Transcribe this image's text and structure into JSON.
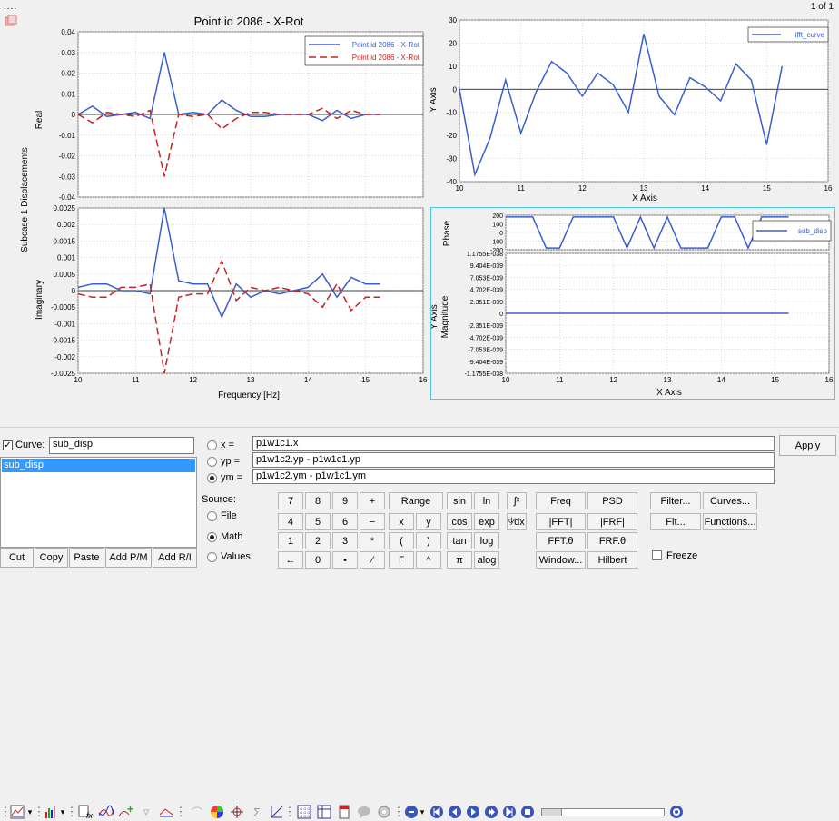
{
  "page_indicator": "1 of 1",
  "plot_main": {
    "title": "Point id 2086 - X-Rot",
    "y_label_outer": "Subcase 1 Displacements",
    "top_ylabel": "Real",
    "bottom_ylabel": "Imaginary",
    "xlabel": "Frequency [Hz]",
    "legend": [
      "Point id 2086 - X-Rot",
      "Point id 2086 - X-Rot"
    ],
    "top_yticks": [
      "0.04",
      "0.03",
      "0.02",
      "0.01",
      "0",
      "-0.01",
      "-0.02",
      "-0.03",
      "-0.04"
    ],
    "bottom_yticks": [
      "0.0025",
      "0.002",
      "0.0015",
      "0.001",
      "0.0005",
      "0",
      "-0.0005",
      "-0.001",
      "-0.0015",
      "-0.002",
      "-0.0025"
    ],
    "xticks": [
      "10",
      "11",
      "12",
      "13",
      "14",
      "15",
      "16"
    ]
  },
  "plot_ifft": {
    "legend": "ifft_curve",
    "xlabel": "X Axis",
    "ylabel": "Y Axis",
    "yticks": [
      "30",
      "20",
      "10",
      "0",
      "-10",
      "-20",
      "-30",
      "-40"
    ],
    "xticks": [
      "10",
      "11",
      "12",
      "13",
      "14",
      "15",
      "16"
    ]
  },
  "plot_sub": {
    "legend": "sub_disp",
    "phase_label": "Phase",
    "phase_ticks": [
      "200",
      "100",
      "0",
      "-100",
      "-200"
    ],
    "mag_label": "Magnitude",
    "yaxis_label": "Y Axis",
    "mag_ticks": [
      "1.1755E-038",
      "9.404E-039",
      "7.053E-039",
      "4.702E-039",
      "2.351E-039",
      "0",
      "-2.351E-039",
      "-4.702E-039",
      "-7.053E-039",
      "-9.404E-039",
      "-1.1755E-038"
    ],
    "xticks": [
      "10",
      "11",
      "12",
      "13",
      "14",
      "15",
      "16"
    ],
    "xlabel": "X Axis"
  },
  "chart_data": [
    {
      "type": "line",
      "title": "Point id 2086 - X-Rot",
      "xlabel": "Frequency [Hz]",
      "ylabel": "Real",
      "xlim": [
        10,
        16
      ],
      "ylim": [
        -0.04,
        0.04
      ],
      "x": [
        10,
        10.25,
        10.5,
        10.75,
        11,
        11.25,
        11.5,
        11.75,
        12,
        12.25,
        12.5,
        12.75,
        13,
        13.25,
        13.5,
        13.75,
        14,
        14.25,
        14.5,
        14.75,
        15,
        15.25
      ],
      "series": [
        {
          "name": "Point id 2086 - X-Rot",
          "color": "#3a5fcd",
          "values": [
            0,
            0.004,
            -0.001,
            0,
            0.001,
            -0.002,
            0.03,
            0,
            0.001,
            0,
            0.007,
            0.002,
            -0.001,
            -0.001,
            0,
            0,
            0,
            -0.003,
            0.002,
            -0.002,
            0,
            0
          ]
        },
        {
          "name": "Point id 2086 - X-Rot",
          "color": "#cc2222",
          "values": [
            0,
            -0.004,
            0.001,
            0,
            -0.001,
            0.002,
            -0.03,
            0,
            -0.001,
            0,
            -0.007,
            -0.002,
            0.001,
            0.001,
            0,
            0,
            0,
            0.003,
            -0.002,
            0.002,
            0,
            0
          ]
        }
      ]
    },
    {
      "type": "line",
      "xlabel": "Frequency [Hz]",
      "ylabel": "Imaginary",
      "xlim": [
        10,
        16
      ],
      "ylim": [
        -0.0025,
        0.0025
      ],
      "x": [
        10,
        10.25,
        10.5,
        10.75,
        11,
        11.25,
        11.5,
        11.75,
        12,
        12.25,
        12.5,
        12.75,
        13,
        13.25,
        13.5,
        13.75,
        14,
        14.25,
        14.5,
        14.75,
        15,
        15.25
      ],
      "series": [
        {
          "name": "Point id 2086 - X-Rot",
          "color": "#3a5fcd",
          "values": [
            0.0001,
            0.0002,
            0.0002,
            0,
            0,
            -0.0001,
            0.0025,
            0.0003,
            0.0002,
            0.0002,
            -0.0008,
            0.0002,
            -0.0002,
            0,
            -0.0001,
            0,
            0.0001,
            0.0005,
            -0.0002,
            0.0004,
            0.0002,
            0.0002
          ]
        },
        {
          "name": "Point id 2086 - X-Rot",
          "color": "#cc2222",
          "values": [
            -0.0001,
            -0.0002,
            -0.0002,
            0.0001,
            0.0001,
            0.0002,
            -0.0025,
            -0.0002,
            -0.0001,
            -0.0001,
            0.0009,
            -0.0003,
            0.0001,
            0,
            0.0001,
            0,
            -0.0001,
            -0.0005,
            0.0002,
            -0.0006,
            -0.0002,
            -0.0002
          ]
        }
      ]
    },
    {
      "type": "line",
      "xlabel": "X Axis",
      "ylabel": "Y Axis",
      "xlim": [
        10,
        16
      ],
      "ylim": [
        -40,
        30
      ],
      "x": [
        10,
        10.25,
        10.5,
        10.75,
        11,
        11.25,
        11.5,
        11.75,
        12,
        12.25,
        12.5,
        12.75,
        13,
        13.25,
        13.5,
        13.75,
        14,
        14.25,
        14.5,
        14.75,
        15,
        15.25
      ],
      "series": [
        {
          "name": "ifft_curve",
          "color": "#3a5fcd",
          "values": [
            0,
            -37,
            -21,
            4,
            -19,
            -1,
            12,
            7,
            -3,
            7,
            2,
            -10,
            24,
            -3,
            -11,
            5,
            1,
            -5,
            11,
            4,
            -24,
            10
          ]
        }
      ]
    },
    {
      "type": "line",
      "xlabel": "X Axis",
      "ylabel": "Phase",
      "xlim": [
        10,
        16
      ],
      "ylim": [
        -200,
        200
      ],
      "x": [
        10,
        10.25,
        10.5,
        10.75,
        11,
        11.25,
        11.5,
        11.75,
        12,
        12.25,
        12.5,
        12.75,
        13,
        13.25,
        13.5,
        13.75,
        14,
        14.25,
        14.5,
        14.75,
        15,
        15.25
      ],
      "series": [
        {
          "name": "sub_disp",
          "color": "#3a5fcd",
          "values": [
            180,
            180,
            180,
            -180,
            -180,
            180,
            180,
            180,
            180,
            -180,
            180,
            -180,
            180,
            -180,
            -180,
            -180,
            180,
            180,
            -180,
            180,
            180,
            180
          ]
        }
      ]
    },
    {
      "type": "line",
      "xlabel": "X Axis",
      "ylabel": "Magnitude",
      "xlim": [
        10,
        16
      ],
      "ylim": [
        -1.1755e-38,
        1.1755e-38
      ],
      "x": [
        10,
        10.25,
        10.5,
        10.75,
        11,
        11.25,
        11.5,
        11.75,
        12,
        12.25,
        12.5,
        12.75,
        13,
        13.25,
        13.5,
        13.75,
        14,
        14.25,
        14.5,
        14.75,
        15,
        15.25
      ],
      "series": [
        {
          "name": "sub_disp",
          "color": "#3a5fcd",
          "values": [
            0,
            0,
            0,
            0,
            0,
            0,
            0,
            0,
            0,
            0,
            0,
            0,
            0,
            0,
            0,
            0,
            0,
            0,
            0,
            0,
            0,
            0
          ]
        }
      ]
    }
  ],
  "curve_panel": {
    "curve_label": "Curve:",
    "curve_name": "sub_disp",
    "list_items": [
      "sub_disp"
    ],
    "buttons": [
      "Cut",
      "Copy",
      "Paste",
      "Add P/M",
      "Add R/I"
    ]
  },
  "expr": {
    "x_label": "x =",
    "x_value": "p1w1c1.x",
    "yp_label": "yp =",
    "yp_value": "p1w1c2.yp - p1w1c1.yp",
    "ym_label": "ym =",
    "ym_value": "p1w1c2.ym - p1w1c1.ym",
    "apply": "Apply"
  },
  "source": {
    "label": "Source:",
    "options": [
      "File",
      "Math",
      "Values"
    ],
    "selected": "Math"
  },
  "calculator": {
    "keys": [
      [
        "7",
        "8",
        "9",
        "+"
      ],
      [
        "4",
        "5",
        "6",
        "−"
      ],
      [
        "1",
        "2",
        "3",
        "*"
      ],
      [
        "←",
        "0",
        "•",
        "⁄"
      ]
    ],
    "range": "Range",
    "ops": [
      [
        "x",
        "y"
      ],
      [
        "(",
        ")"
      ],
      [
        "Γ",
        "^"
      ]
    ],
    "funcs": [
      [
        "sin",
        "ln"
      ],
      [
        "cos",
        "exp"
      ],
      [
        "tan",
        "log"
      ],
      [
        "π",
        "alog"
      ]
    ],
    "calc_funcs": [
      [
        "Freq",
        "PSD"
      ],
      [
        "|FFT|",
        "|FRF|"
      ],
      [
        "FFT.θ",
        "FRF.θ"
      ],
      [
        "Window...",
        "Hilbert"
      ]
    ],
    "tools": [
      "Filter...",
      "Curves...",
      "Fit...",
      "Functions..."
    ],
    "freeze": "Freeze"
  }
}
